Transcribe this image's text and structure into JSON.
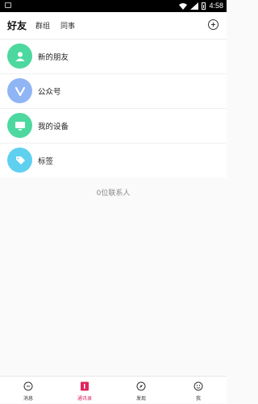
{
  "status_bar": {
    "time": "4:58"
  },
  "header": {
    "active_tab": "好友",
    "tabs": [
      "群组",
      "同事"
    ]
  },
  "list": {
    "items": [
      {
        "label": "新的朋友",
        "icon": "person-icon",
        "color": "#4dd8a0"
      },
      {
        "label": "公众号",
        "icon": "v-icon",
        "color": "#8fb5f5"
      },
      {
        "label": "我的设备",
        "icon": "monitor-icon",
        "color": "#4dd8a0"
      },
      {
        "label": "标签",
        "icon": "tag-icon",
        "color": "#5fd0f0"
      }
    ]
  },
  "contact_count": "0位联系人",
  "bottom_nav": {
    "items": [
      {
        "label": "消息",
        "icon": "chat-icon"
      },
      {
        "label": "通讯录",
        "icon": "contacts-icon"
      },
      {
        "label": "发现",
        "icon": "compass-icon"
      },
      {
        "label": "我",
        "icon": "profile-icon"
      }
    ],
    "active_color": "#e0245e"
  }
}
